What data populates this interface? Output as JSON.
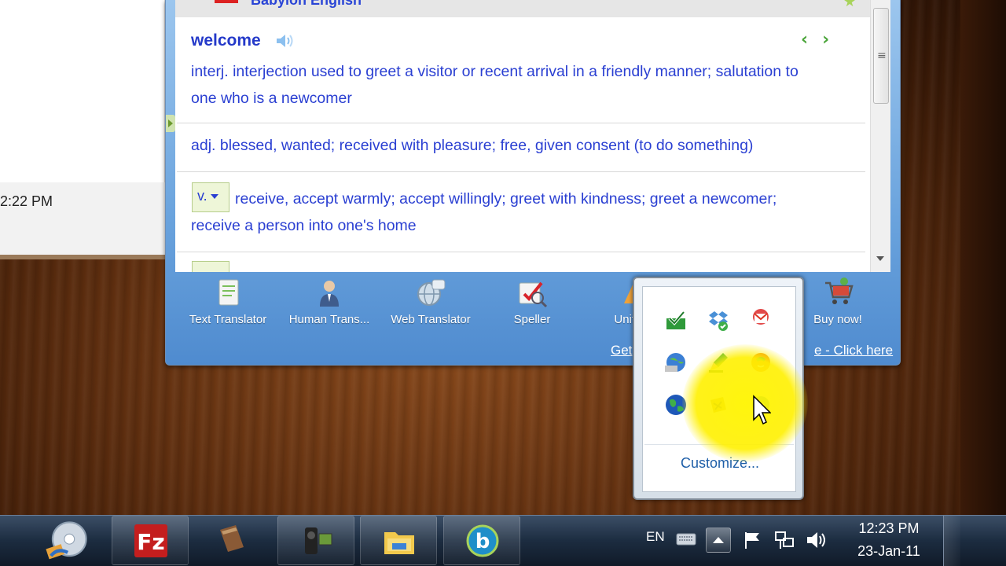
{
  "background_window": {
    "time_text": "2:22 PM"
  },
  "babylon": {
    "title_brand": "Babylon English",
    "entry": {
      "headword": "welcome",
      "def_interj": "interj. interjection used to greet a visitor or recent arrival in a friendly manner; salutation to one who is a newcomer",
      "def_adj": "adj. blessed, wanted; received with pleasure; free, given consent (to do something)",
      "pos_verb": "v.",
      "def_verb": "receive, accept warmly; accept willingly; greet with kindness; greet a newcomer; receive a person into one's home"
    },
    "nav": {
      "prev": "‹",
      "next": "›"
    },
    "toolbar": [
      {
        "label": "Text Translator",
        "icon": "document-icon"
      },
      {
        "label": "Human Trans...",
        "icon": "person-icon"
      },
      {
        "label": "Web Translator",
        "icon": "globe-icon"
      },
      {
        "label": "Speller",
        "icon": "spellcheck-icon"
      },
      {
        "label": "Units C",
        "icon": "units-icon"
      },
      {
        "label": "Buy now!",
        "icon": "cart-icon"
      }
    ],
    "get_link": "Get",
    "click_link": "e - Click here"
  },
  "tray_popup": {
    "customize": "Customize...",
    "icons": [
      "green-check-icon",
      "dropbox-icon",
      "gmail-icon",
      "network-globe-icon",
      "pencil-icon",
      "phone-icon",
      "earth-icon",
      "dvd-icon",
      "babylon-tray-icon"
    ]
  },
  "taskbar": {
    "language": "EN",
    "time": "12:23 PM",
    "date": "23-Jan-11",
    "pinned": [
      "media-player-icon",
      "filezilla-icon",
      "book-icon",
      "camcorder-icon",
      "folder-icon",
      "babylon-app-icon"
    ]
  },
  "colors": {
    "link_blue": "#2a3fd2",
    "accent_green": "#4ba53a",
    "highlight": "#fff000"
  }
}
